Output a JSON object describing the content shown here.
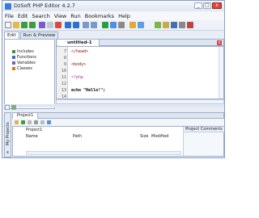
{
  "window": {
    "title": "DzSoft PHP Editor 4.2.7",
    "min": "_",
    "max": "□",
    "close": "x"
  },
  "menu": [
    "File",
    "Edit",
    "Search",
    "View",
    "Run",
    "Bookmarks",
    "Help"
  ],
  "left_tabs": [
    "Edit",
    "Run & Preview"
  ],
  "tree": [
    "Includes",
    "Functions",
    "Variables",
    "Classes"
  ],
  "editor": {
    "tab": "untitled-1",
    "close": "x",
    "lines": [
      {
        "n": "7",
        "text": "</head>"
      },
      {
        "n": "8",
        "text": ""
      },
      {
        "n": "9",
        "text": "<body>"
      },
      {
        "n": "10",
        "text": ""
      },
      {
        "n": "11",
        "text": "<?php"
      },
      {
        "n": "12",
        "text": ""
      },
      {
        "n": "13",
        "text": "echo \"Hello!\";"
      },
      {
        "n": "14",
        "text": ""
      }
    ]
  },
  "projects": {
    "side_label": "My Projects",
    "side_close": "x",
    "tab": "Project1",
    "name": "Project1",
    "columns": [
      "Name",
      "Path",
      "Size",
      "Modified"
    ],
    "comments_header": "Project Comments"
  }
}
